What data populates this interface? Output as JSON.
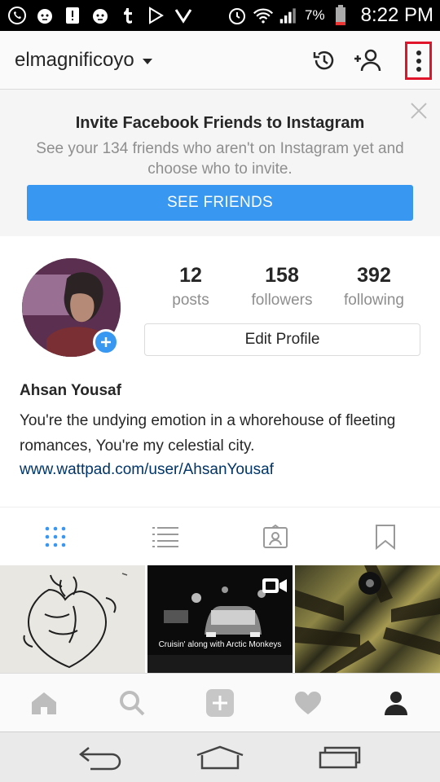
{
  "status_bar": {
    "battery_percent": "7%",
    "time": "8:22 PM",
    "icons": [
      "whatsapp-icon",
      "tiger-app-icon",
      "notification-icon",
      "tiger-app-icon",
      "tumblr-icon",
      "play-store-icon",
      "download-check-icon",
      "alarm-icon",
      "wifi-icon",
      "signal-icon",
      "battery-icon"
    ]
  },
  "header": {
    "username": "elmagnificoyo",
    "icons": [
      "history-icon",
      "add-person-icon",
      "more-vertical-icon"
    ]
  },
  "invite_banner": {
    "title": "Invite Facebook Friends to Instagram",
    "subtitle": "See your 134 friends who aren't on Instagram yet and choose who to invite.",
    "button_label": "SEE FRIENDS"
  },
  "profile": {
    "stats": [
      {
        "value": "12",
        "label": "posts"
      },
      {
        "value": "158",
        "label": "followers"
      },
      {
        "value": "392",
        "label": "following"
      }
    ],
    "edit_button": "Edit Profile",
    "full_name": "Ahsan Yousaf",
    "bio": "You're the undying emotion in a whorehouse of fleeting romances, You're my celestial city.",
    "website": "www.wattpad.com/user/AhsanYousaf"
  },
  "tabs": [
    "grid-view",
    "list-view",
    "tagged",
    "saved"
  ],
  "grid_posts": [
    {
      "caption": ""
    },
    {
      "caption": "Cruisin' along with Arctic Monkeys"
    },
    {
      "caption": ""
    }
  ],
  "bottom_nav": [
    "home-icon",
    "search-icon",
    "add-icon",
    "activity-heart-icon",
    "profile-icon"
  ],
  "system_nav": [
    "back-icon",
    "home-icon",
    "recents-icon"
  ],
  "colors": {
    "accent": "#3897f0",
    "highlight_box": "#e0142a",
    "link": "#003569"
  }
}
